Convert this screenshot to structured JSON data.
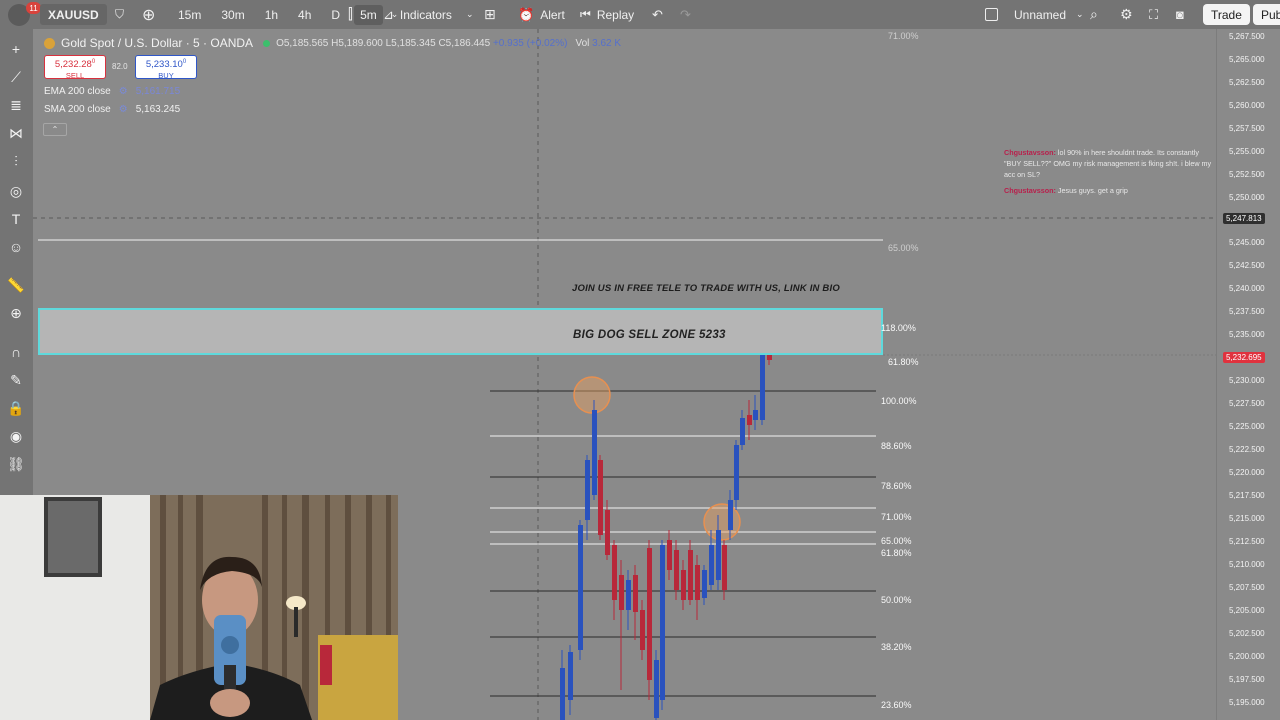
{
  "topbar": {
    "notification_count": "11",
    "symbol": "XAUUSD",
    "timeframes": [
      "15m",
      "30m",
      "1h",
      "4h",
      "D",
      "5m"
    ],
    "active_timeframe": "5m",
    "indicators_label": "Indicators",
    "alert_label": "Alert",
    "replay_label": "Replay",
    "layout_name": "Unnamed",
    "trade_label": "Trade",
    "publish_label": "Pub"
  },
  "legend": {
    "title": "Gold Spot / U.S. Dollar · 5 · OANDA",
    "open": "O5,185.565",
    "high": "H5,189.600",
    "low": "L5,185.345",
    "close": "C5,186.445",
    "change": "+0.935 (+0.02%)",
    "vol": "Vol",
    "vol_value": "3.62 K",
    "sell_price": "5,232.28",
    "sell_sup": "0",
    "sell_label": "SELL",
    "spread": "82.0",
    "buy_price": "5,233.10",
    "buy_sup": "0",
    "buy_label": "BUY",
    "ema_label": "EMA 200 close",
    "ema_value": "5,161.715",
    "sma_label": "SMA 200 close",
    "sma_value": "5,163.245"
  },
  "price_axis": {
    "labels": [
      "5,267.500",
      "5,265.000",
      "5,262.500",
      "5,260.000",
      "5,257.500",
      "5,255.000",
      "5,252.500",
      "5,250.000",
      "5,245.000",
      "5,242.500",
      "5,240.000",
      "5,237.500",
      "5,235.000",
      "5,230.000",
      "5,227.500",
      "5,225.000",
      "5,222.500",
      "5,220.000",
      "5,217.500",
      "5,215.000",
      "5,212.500",
      "5,210.000",
      "5,207.500",
      "5,205.000",
      "5,202.500",
      "5,200.000",
      "5,197.500",
      "5,195.000"
    ],
    "crosshair_price": "5,247.813",
    "current_price": "5,232.695",
    "current_color": "#e0323e"
  },
  "chat": [
    {
      "user": "Chgustavsson:",
      "text": "lol 90% in here shouldnt trade. Its constantly \"BUY SELL??\" OMG my risk management is fking sh!t. i blew my acc on SL?"
    },
    {
      "user": "Chgustavsson:",
      "text": "Jesus guys. get a grip"
    }
  ],
  "annotations": {
    "join_text": "JOIN US IN FREE TELE TO TRADE WITH US, LINK IN BIO",
    "zone_text": "BIG DOG SELL ZONE 5233"
  },
  "fib_levels": [
    {
      "label": "71.00%"
    },
    {
      "label": "65.00%"
    },
    {
      "label": "118.00%"
    },
    {
      "label": "61.80%"
    },
    {
      "label": "100.00%"
    },
    {
      "label": "88.60%"
    },
    {
      "label": "78.60%"
    },
    {
      "label": "71.00%"
    },
    {
      "label": "65.00%"
    },
    {
      "label": "61.80%"
    },
    {
      "label": "50.00%"
    },
    {
      "label": "38.20%"
    },
    {
      "label": "23.60%"
    }
  ],
  "colors": {
    "bull": "#2a52be",
    "bear": "#b8283a",
    "zone_border": "#5fd9dc",
    "chat_user": "#b8204c"
  }
}
